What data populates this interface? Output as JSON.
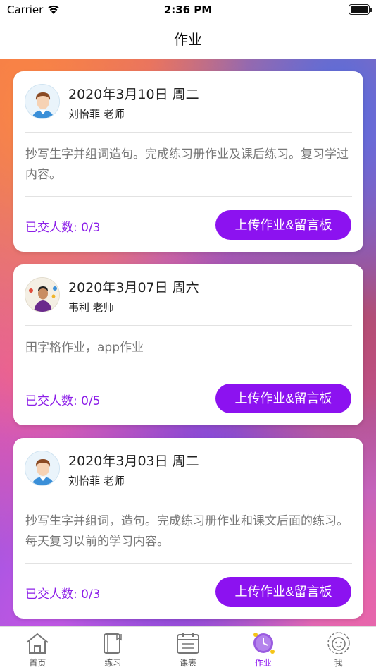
{
  "status_bar": {
    "carrier": "Carrier",
    "time": "2:36 PM"
  },
  "nav": {
    "title": "作业"
  },
  "colors": {
    "accent": "#8c12f0",
    "count_text": "#8c1ee8"
  },
  "homework": [
    {
      "date": "2020年3月10日 周二",
      "teacher": "刘怡菲 老师",
      "description": "抄写生字并组词造句。完成练习册作业及课后练习。复习学过内容。",
      "submitted": "已交人数: 0/3",
      "button": "上传作业&留言板",
      "avatar_icon": "teacher-avatar-icon"
    },
    {
      "date": "2020年3月07日 周六",
      "teacher": "韦利 老师",
      "description": "田字格作业，app作业",
      "submitted": "已交人数: 0/5",
      "button": "上传作业&留言板",
      "avatar_icon": "teacher-photo-avatar"
    },
    {
      "date": "2020年3月03日 周二",
      "teacher": "刘怡菲 老师",
      "description": "抄写生字并组词，造句。完成练习册作业和课文后面的练习。每天复习以前的学习内容。",
      "submitted": "已交人数: 0/3",
      "button": "上传作业&留言板",
      "avatar_icon": "teacher-avatar-icon"
    }
  ],
  "tabs": [
    {
      "label": "首页",
      "icon": "home-icon"
    },
    {
      "label": "练习",
      "icon": "notebook-icon"
    },
    {
      "label": "课表",
      "icon": "schedule-icon"
    },
    {
      "label": "作业",
      "icon": "homework-clock-icon",
      "active": true
    },
    {
      "label": "我",
      "icon": "lion-face-icon"
    }
  ]
}
